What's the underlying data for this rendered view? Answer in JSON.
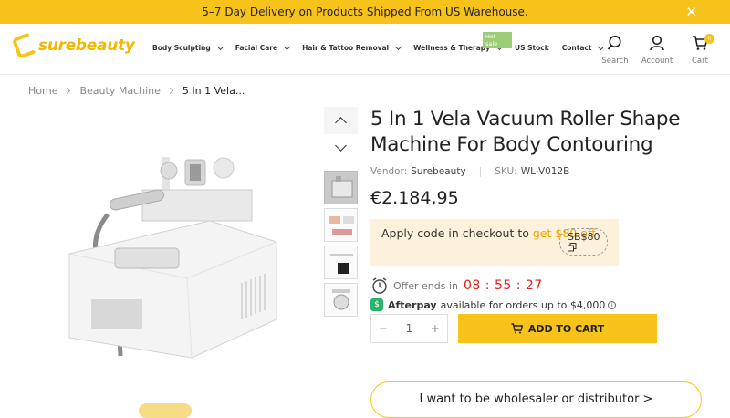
{
  "announcement": {
    "text": "5–7 Day Delivery on Products Shipped From US Warehouse.",
    "close_icon": "close-icon"
  },
  "header": {
    "logo_text": "surebeauty",
    "nav": [
      {
        "label": "Body Sculpting",
        "has_dropdown": true
      },
      {
        "label": "Facial Care",
        "has_dropdown": true
      },
      {
        "label": "Hair & Tattoo Removal",
        "has_dropdown": true
      },
      {
        "label": "Wellness & Therapy",
        "has_dropdown": true
      },
      {
        "label": "US Stock",
        "has_dropdown": false
      },
      {
        "label": "Contact",
        "has_dropdown": true
      }
    ],
    "hot_badge": "Hot sale",
    "search_label": "Search",
    "account_label": "Account",
    "cart_label": "Cart",
    "cart_count": "0"
  },
  "breadcrumb": {
    "home": "Home",
    "category": "Beauty Machine",
    "current": "5 In 1 Vela..."
  },
  "product": {
    "title": "5 In 1 Vela Vacuum Roller Shape Machine For Body Contouring",
    "vendor_label": "Vendor:",
    "vendor": "Surebeauty",
    "sku_label": "SKU:",
    "sku": "WL-V012B",
    "price": "€2.184,95",
    "promo_text": "Apply code in checkout to",
    "promo_link": "get $80 off",
    "coupon_code": "SB$80",
    "offer_label": "Offer ends in",
    "timer": "08 : 55 : 27",
    "afterpay_name": "Afterpay",
    "afterpay_text": "available for orders up to $4,000",
    "quantity": "1",
    "minus": "−",
    "plus": "+",
    "add_to_cart": "ADD TO CART",
    "wholesale": "I want to be wholesaler or distributor >"
  },
  "colors": {
    "accent": "#f7c31a",
    "promo_bg": "#fdf1dc",
    "timer": "#e02020",
    "afterpay": "#2ab46a"
  }
}
